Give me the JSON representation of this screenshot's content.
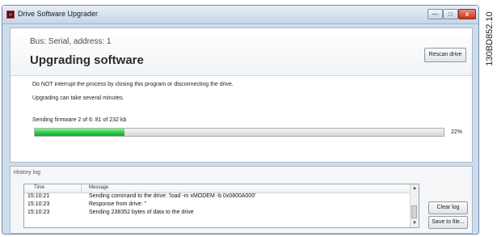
{
  "window": {
    "title": "Drive Software Upgrader",
    "minimize": "—",
    "maximize": "□",
    "close": "x"
  },
  "side_id": "130BD852.10",
  "main": {
    "bus": "Bus: Serial, address: 1",
    "heading": "Upgrading software",
    "rescan_label": "Rescan drive",
    "warning": "Do NOT interrupt the process by closing this program or disconnecting the drive.",
    "info": "Upgrading can take several minutes.",
    "status": "Sending firmware 2 of 6: 81 of 232 kb",
    "progress": {
      "value": 0.22,
      "label": "22%"
    }
  },
  "history": {
    "title": "History log",
    "columns": {
      "time": "Time",
      "message": "Message"
    },
    "rows": [
      {
        "time": "15:10:21",
        "message": "Sending command to the drive: 'load -m xMODEM -b 0x0800A000'"
      },
      {
        "time": "15:10:23",
        "message": "Response from drive: ''"
      },
      {
        "time": "15:10:23",
        "message": "Sending 238352 bytes of data to the drive"
      }
    ],
    "clear_label": "Clear log",
    "save_label": "Save to file..."
  },
  "scroll": {
    "up": "▲",
    "down": "▼"
  }
}
